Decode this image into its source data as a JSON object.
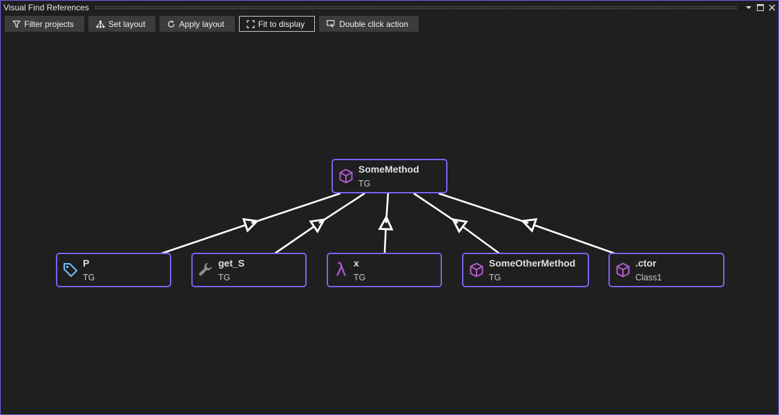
{
  "window": {
    "title": "Visual Find References"
  },
  "toolbar": {
    "buttons": [
      {
        "label": "Filter projects",
        "icon": "filter-icon"
      },
      {
        "label": "Set layout",
        "icon": "hierarchy-icon"
      },
      {
        "label": "Apply layout",
        "icon": "refresh-icon"
      },
      {
        "label": "Fit to display",
        "icon": "fit-icon"
      },
      {
        "label": "Double click action",
        "icon": "click-action-icon"
      }
    ]
  },
  "graph": {
    "root": {
      "title": "SomeMethod",
      "subtitle": "TG",
      "icon": "method-icon"
    },
    "children": [
      {
        "title": "P",
        "subtitle": "TG",
        "icon": "property-tag-icon"
      },
      {
        "title": "get_S",
        "subtitle": "TG",
        "icon": "wrench-icon"
      },
      {
        "title": "x",
        "subtitle": "TG",
        "icon": "lambda-icon",
        "glyph": "λ"
      },
      {
        "title": "SomeOtherMethod",
        "subtitle": "TG",
        "icon": "method-icon"
      },
      {
        "title": ".ctor",
        "subtitle": "Class1",
        "icon": "method-icon"
      }
    ]
  },
  "colors": {
    "background": "#1f1f1f",
    "node_border": "#7a63f2",
    "edge": "#ffffff",
    "method_icon": "#b45bcf",
    "property_icon": "#75beff",
    "wrench_icon": "#8c8c8c"
  }
}
